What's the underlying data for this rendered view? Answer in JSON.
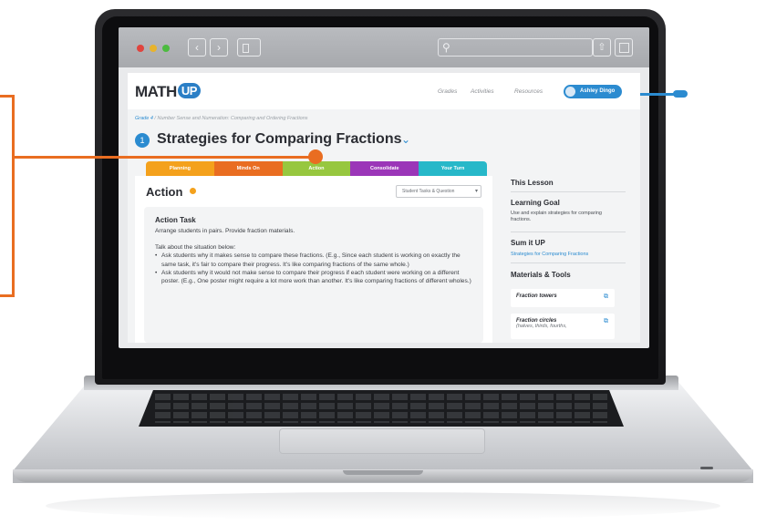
{
  "brand": {
    "name": "MATH",
    "badge": "UP",
    "accent": "#2b8bd0",
    "callout_orange": "#e96d21"
  },
  "browser": {
    "traffic_lights": [
      "close",
      "minimize",
      "maximize"
    ],
    "back_icon": "chevron-left-icon",
    "forward_icon": "chevron-right-icon",
    "search_placeholder": ""
  },
  "nav": {
    "grades": "Grades",
    "activities": "Activities",
    "resources": "Resources",
    "user": "Ashley Dingo"
  },
  "breadcrumb": {
    "grade": "Grade 4",
    "separator": "/",
    "path": "Number Sense and Numeration: Comparing and Ordering Fractions"
  },
  "lesson": {
    "number": "1",
    "title": "Strategies for Comparing Fractions"
  },
  "stage_tabs": [
    {
      "label": "Planning",
      "color": "#f4a11c"
    },
    {
      "label": "Minds On",
      "color": "#e96d21"
    },
    {
      "label": "Action",
      "color": "#97c73f"
    },
    {
      "label": "Consolidate",
      "color": "#9b36b8"
    },
    {
      "label": "Your Turn",
      "color": "#27b8c9"
    }
  ],
  "main": {
    "section_title": "Action",
    "view_select": "Student Tasks & Question",
    "task": {
      "heading": "Action Task",
      "intro": "Arrange students in pairs. Provide fraction materials.",
      "talk": "Talk about the situation below:",
      "bullets": [
        "Ask students why it makes sense to compare these fractions. (E.g., Since each student is working on exactly the same task, it's fair to compare their progress. It's like comparing fractions of the same whole.)",
        "Ask students why it would not make sense to compare their progress if each student were working on a different poster. (E.g., One poster might require a lot more work than another. It's like comparing fractions of different wholes.)"
      ]
    }
  },
  "side": {
    "this_lesson": "This Lesson",
    "learning_goal_h": "Learning Goal",
    "learning_goal": "Use and explain strategies for comparing fractions.",
    "sum_it_up_h": "Sum it UP",
    "sum_it_up_link": "Strategies for Comparing Fractions",
    "materials_h": "Materials & Tools",
    "materials": [
      {
        "name": "Fraction towers",
        "sub": ""
      },
      {
        "name": "Fraction circles",
        "sub": "(halves, thirds, fourths,"
      }
    ]
  }
}
